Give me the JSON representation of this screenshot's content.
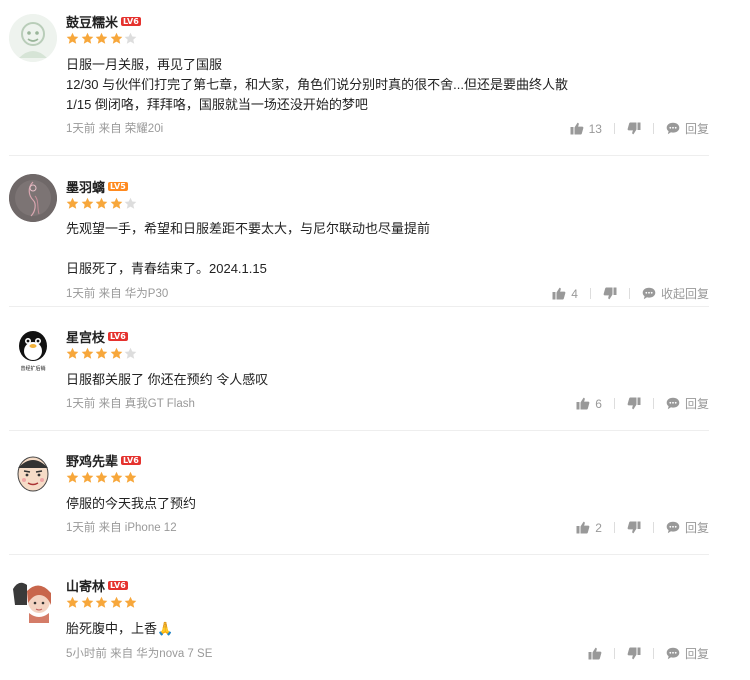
{
  "colors": {
    "star_active": "#f7a73b",
    "star_inactive": "#dddddd",
    "level_badge_red": "#e5322e",
    "level_badge_orange": "#ff8a1f",
    "meta_gray": "#999999"
  },
  "comments": [
    {
      "username": "鼓豆糯米",
      "level": "LV6",
      "rating": 4,
      "rating_max": 5,
      "lines": [
        "日服一月关服，再见了国服",
        "12/30 与伙伴们打完了第七章，和大家，角色们说分别时真的很不舍...但还是要曲终人散",
        "1/15 倒闭咯，拜拜咯，国服就当一场还没开始的梦吧"
      ],
      "time": "1天前",
      "source": "来自 荣耀20i",
      "likes": "13",
      "reply_label": "回复"
    },
    {
      "username": "墨羽螭",
      "level": "LV5",
      "rating": 4,
      "rating_max": 5,
      "lines": [
        "先观望一手，希望和日服差距不要太大，与尼尔联动也尽量提前",
        "",
        "日服死了，青春结束了。2024.1.15"
      ],
      "time": "1天前",
      "source": "来自 华为P30",
      "likes": "4",
      "reply_label": "收起回复"
    },
    {
      "username": "星宫枝",
      "level": "LV6",
      "rating": 4,
      "rating_max": 5,
      "avatar_caption": "曾经扩后销",
      "lines": [
        "日服都关服了 你还在预约 令人感叹"
      ],
      "time": "1天前",
      "source": "来自 真我GT Flash",
      "likes": "6",
      "reply_label": "回复"
    },
    {
      "username": "野鸡先辈",
      "level": "LV6",
      "rating": 5,
      "rating_max": 5,
      "lines": [
        "停服的今天我点了预约"
      ],
      "time": "1天前",
      "source": "来自 iPhone 12",
      "likes": "2",
      "reply_label": "回复"
    },
    {
      "username": "山寄林",
      "level": "LV6",
      "rating": 5,
      "rating_max": 5,
      "lines": [
        "胎死腹中，上香🙏"
      ],
      "time": "5小时前",
      "source": "来自 华为nova 7 SE",
      "likes": "",
      "reply_label": "回复"
    }
  ]
}
